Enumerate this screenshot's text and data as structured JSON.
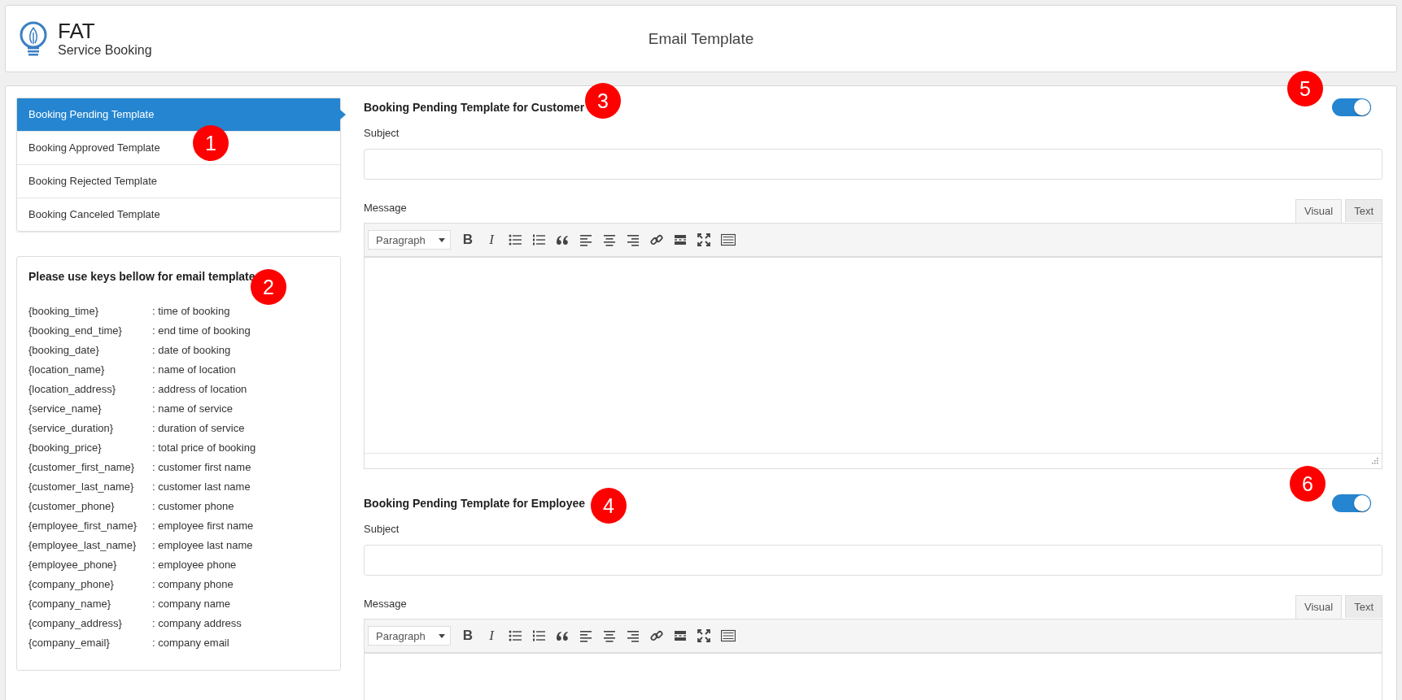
{
  "header": {
    "logo": {
      "title": "FAT",
      "subtitle": "Service Booking"
    },
    "page_title": "Email Template"
  },
  "sidebar": {
    "items": [
      {
        "label": "Booking Pending Template",
        "selected": true
      },
      {
        "label": "Booking Approved Template",
        "selected": false
      },
      {
        "label": "Booking Rejected Template",
        "selected": false
      },
      {
        "label": "Booking Canceled Template",
        "selected": false
      }
    ]
  },
  "keys_card": {
    "title": "Please use keys bellow for email template",
    "keys": [
      {
        "key": "{booking_time}",
        "description": ": time of booking"
      },
      {
        "key": "{booking_end_time}",
        "description": ": end time of booking"
      },
      {
        "key": "{booking_date}",
        "description": ": date of booking"
      },
      {
        "key": "{location_name}",
        "description": ": name of location"
      },
      {
        "key": "{location_address}",
        "description": ": address of location"
      },
      {
        "key": "{service_name}",
        "description": ": name of service"
      },
      {
        "key": "{service_duration}",
        "description": ": duration of service"
      },
      {
        "key": "{booking_price}",
        "description": ": total price of booking"
      },
      {
        "key": "{customer_first_name}",
        "description": ": customer first name"
      },
      {
        "key": "{customer_last_name}",
        "description": ": customer last name"
      },
      {
        "key": "{customer_phone}",
        "description": ": customer phone"
      },
      {
        "key": "{employee_first_name}",
        "description": ": employee first name"
      },
      {
        "key": "{employee_last_name}",
        "description": ": employee last name"
      },
      {
        "key": "{employee_phone}",
        "description": ": employee phone"
      },
      {
        "key": "{company_phone}",
        "description": ": company phone"
      },
      {
        "key": "{company_name}",
        "description": ": company name"
      },
      {
        "key": "{company_address}",
        "description": ": company address"
      },
      {
        "key": "{company_email}",
        "description": ": company email"
      }
    ]
  },
  "sections": [
    {
      "title": "Booking Pending Template for Customer",
      "on": true,
      "subject_label": "Subject",
      "message_label": "Message",
      "format_select": "Paragraph",
      "editor_tabs": [
        {
          "label": "Visual",
          "selected": true
        },
        {
          "label": "Text",
          "selected": false
        }
      ],
      "toolbar": [
        {
          "kind": "bold",
          "label": "B"
        },
        {
          "kind": "italic",
          "label": "I"
        },
        {
          "kind": "bullet-list"
        },
        {
          "kind": "numbered-list"
        },
        {
          "kind": "quote"
        },
        {
          "kind": "align-left"
        },
        {
          "kind": "align-center"
        },
        {
          "kind": "align-right"
        },
        {
          "kind": "link"
        },
        {
          "kind": "read-more"
        },
        {
          "kind": "fullscreen"
        },
        {
          "kind": "keyboard"
        }
      ]
    },
    {
      "title": "Booking Pending Template for Employee",
      "on": true,
      "subject_label": "Subject",
      "message_label": "Message",
      "format_select": "Paragraph",
      "editor_tabs": [
        {
          "label": "Visual",
          "selected": true
        },
        {
          "label": "Text",
          "selected": false
        }
      ],
      "toolbar": [
        {
          "kind": "bold",
          "label": "B"
        },
        {
          "kind": "italic",
          "label": "I"
        },
        {
          "kind": "bullet-list"
        },
        {
          "kind": "numbered-list"
        },
        {
          "kind": "quote"
        },
        {
          "kind": "align-left"
        },
        {
          "kind": "align-center"
        },
        {
          "kind": "align-right"
        },
        {
          "kind": "link"
        },
        {
          "kind": "read-more"
        },
        {
          "kind": "fullscreen"
        },
        {
          "kind": "keyboard"
        }
      ]
    }
  ],
  "annotations": [
    {
      "label": "1"
    },
    {
      "label": "2"
    },
    {
      "label": "3"
    },
    {
      "label": "4"
    },
    {
      "label": "5"
    },
    {
      "label": "6"
    }
  ]
}
